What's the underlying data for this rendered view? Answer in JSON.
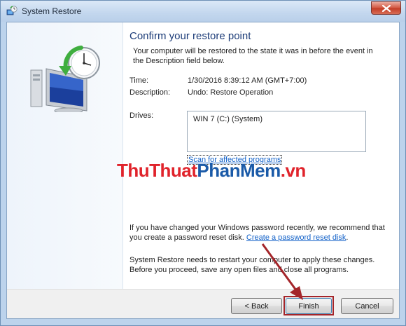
{
  "window": {
    "title": "System Restore"
  },
  "page": {
    "heading": "Confirm your restore point",
    "intro": "Your computer will be restored to the state it was in before the event in the Description field below."
  },
  "details": {
    "time_label": "Time:",
    "time_value": "1/30/2016 8:39:12 AM (GMT+7:00)",
    "description_label": "Description:",
    "description_value": "Undo: Restore Operation",
    "drives_label": "Drives:",
    "drives": [
      "WIN 7 (C:) (System)"
    ]
  },
  "scan_link": "Scan for affected programs",
  "watermark": {
    "part1": "ThuThuat",
    "part2": "PhanMem",
    "part3": ".vn"
  },
  "password_notice": {
    "text": "If you have changed your Windows password recently, we recommend that you create a password reset disk. ",
    "link": "Create a password reset disk",
    "end": "."
  },
  "restart_notice": "System Restore needs to restart your computer to apply these changes. Before you proceed, save any open files and close all programs.",
  "buttons": {
    "back": "< Back",
    "finish": "Finish",
    "cancel": "Cancel"
  },
  "icons": {
    "title": "system-restore-icon",
    "hero": "computer-restore-clock-icon",
    "close": "close-icon"
  },
  "colors": {
    "heading": "#1c3c78",
    "link": "#1060c8",
    "highlight": "#a4252a",
    "watermark_red": "#e0232b",
    "watermark_blue": "#1a5aa8"
  }
}
